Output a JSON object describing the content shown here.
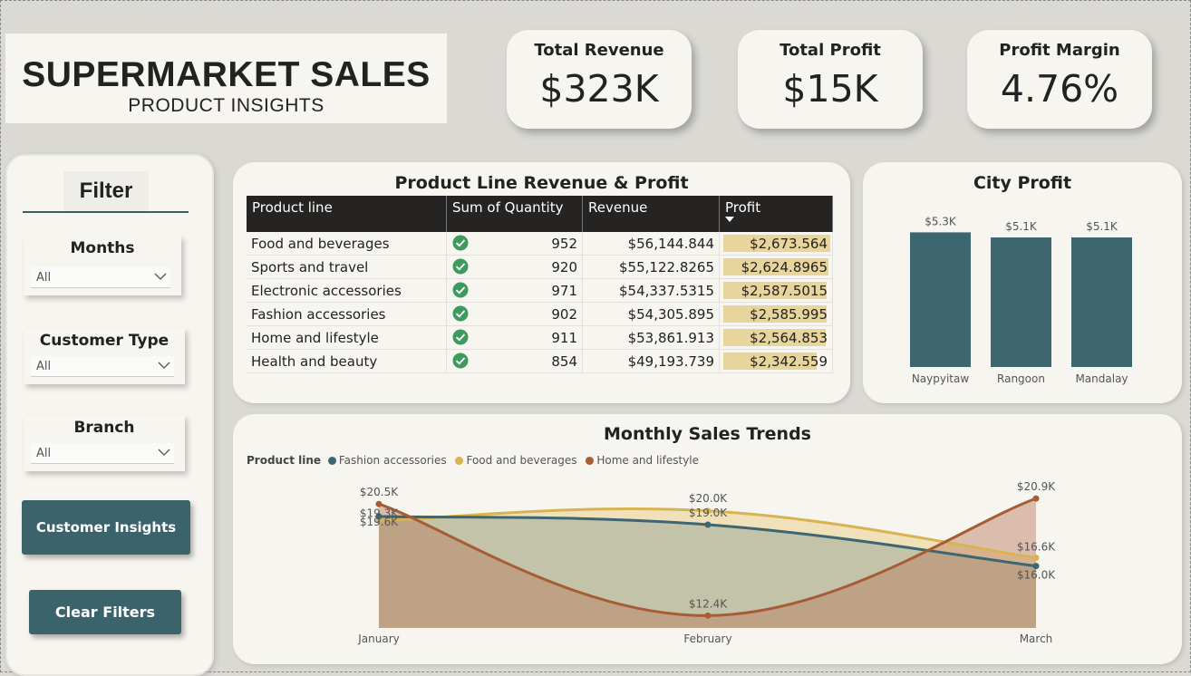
{
  "header": {
    "title": "SUPERMARKET SALES",
    "subtitle": "PRODUCT INSIGHTS"
  },
  "kpis": [
    {
      "label": "Total Revenue",
      "value": "$323K"
    },
    {
      "label": "Total Profit",
      "value": "$15K"
    },
    {
      "label": "Profit Margin",
      "value": "4.76%"
    }
  ],
  "filter": {
    "title": "Filter",
    "slicers": [
      {
        "label": "Months",
        "value": "All"
      },
      {
        "label": "Customer Type",
        "value": "All"
      },
      {
        "label": "Branch",
        "value": "All"
      }
    ],
    "buttons": {
      "insights": "Customer Insights",
      "clear": "Clear Filters"
    }
  },
  "colors": {
    "teal": "#3d6670",
    "gold": "#d8b352",
    "brown": "#a85c35",
    "profit_bar": "#e8d59c",
    "button": "#3b636c"
  },
  "chart_data": [
    {
      "type": "table",
      "title": "Product Line Revenue & Profit",
      "columns": [
        "Product line",
        "Sum of Quantity",
        "Revenue",
        "Profit"
      ],
      "sort": {
        "column": "Profit",
        "direction": "descending"
      },
      "rows": [
        {
          "product": "Food and beverages",
          "quantity": "952",
          "revenue": "$56,144.844",
          "profit": "$2,673.564",
          "profit_value": 2673.564
        },
        {
          "product": "Sports and travel",
          "quantity": "920",
          "revenue": "$55,122.8265",
          "profit": "$2,624.8965",
          "profit_value": 2624.8965
        },
        {
          "product": "Electronic accessories",
          "quantity": "971",
          "revenue": "$54,337.5315",
          "profit": "$2,587.5015",
          "profit_value": 2587.5015
        },
        {
          "product": "Fashion accessories",
          "quantity": "902",
          "revenue": "$54,305.895",
          "profit": "$2,585.995",
          "profit_value": 2585.995
        },
        {
          "product": "Home and lifestyle",
          "quantity": "911",
          "revenue": "$53,861.913",
          "profit": "$2,564.853",
          "profit_value": 2564.853
        },
        {
          "product": "Health and beauty",
          "quantity": "854",
          "revenue": "$49,193.739",
          "profit": "$2,342.559",
          "profit_value": 2342.559
        }
      ]
    },
    {
      "type": "bar",
      "title": "City Profit",
      "categories": [
        "Naypyitaw",
        "Rangoon",
        "Mandalay"
      ],
      "values": [
        5.3,
        5.1,
        5.1
      ],
      "labels": [
        "$5.3K",
        "$5.1K",
        "$5.1K"
      ],
      "ylim": [
        0,
        5.6
      ],
      "grid": false
    },
    {
      "type": "area",
      "title": "Monthly Sales Trends",
      "legend_title": "Product line",
      "legend_position": "top-left",
      "categories": [
        "January",
        "February",
        "March"
      ],
      "series": [
        {
          "name": "Fashion accessories",
          "color": "#3d6670",
          "values": [
            19.6,
            19.0,
            16.0
          ],
          "labels": [
            "$19.6K",
            "$19.0K",
            "$16.0K"
          ]
        },
        {
          "name": "Food and beverages",
          "color": "#d8b352",
          "values": [
            19.3,
            20.0,
            16.6
          ],
          "labels": [
            "$19.3K",
            "$20.0K",
            "$16.6K"
          ]
        },
        {
          "name": "Home and lifestyle",
          "color": "#a85c35",
          "values": [
            20.5,
            12.4,
            20.9
          ],
          "labels": [
            "$20.5K",
            "$12.4K",
            "$20.9K"
          ]
        }
      ],
      "ylim": [
        11.5,
        21.5
      ]
    }
  ]
}
